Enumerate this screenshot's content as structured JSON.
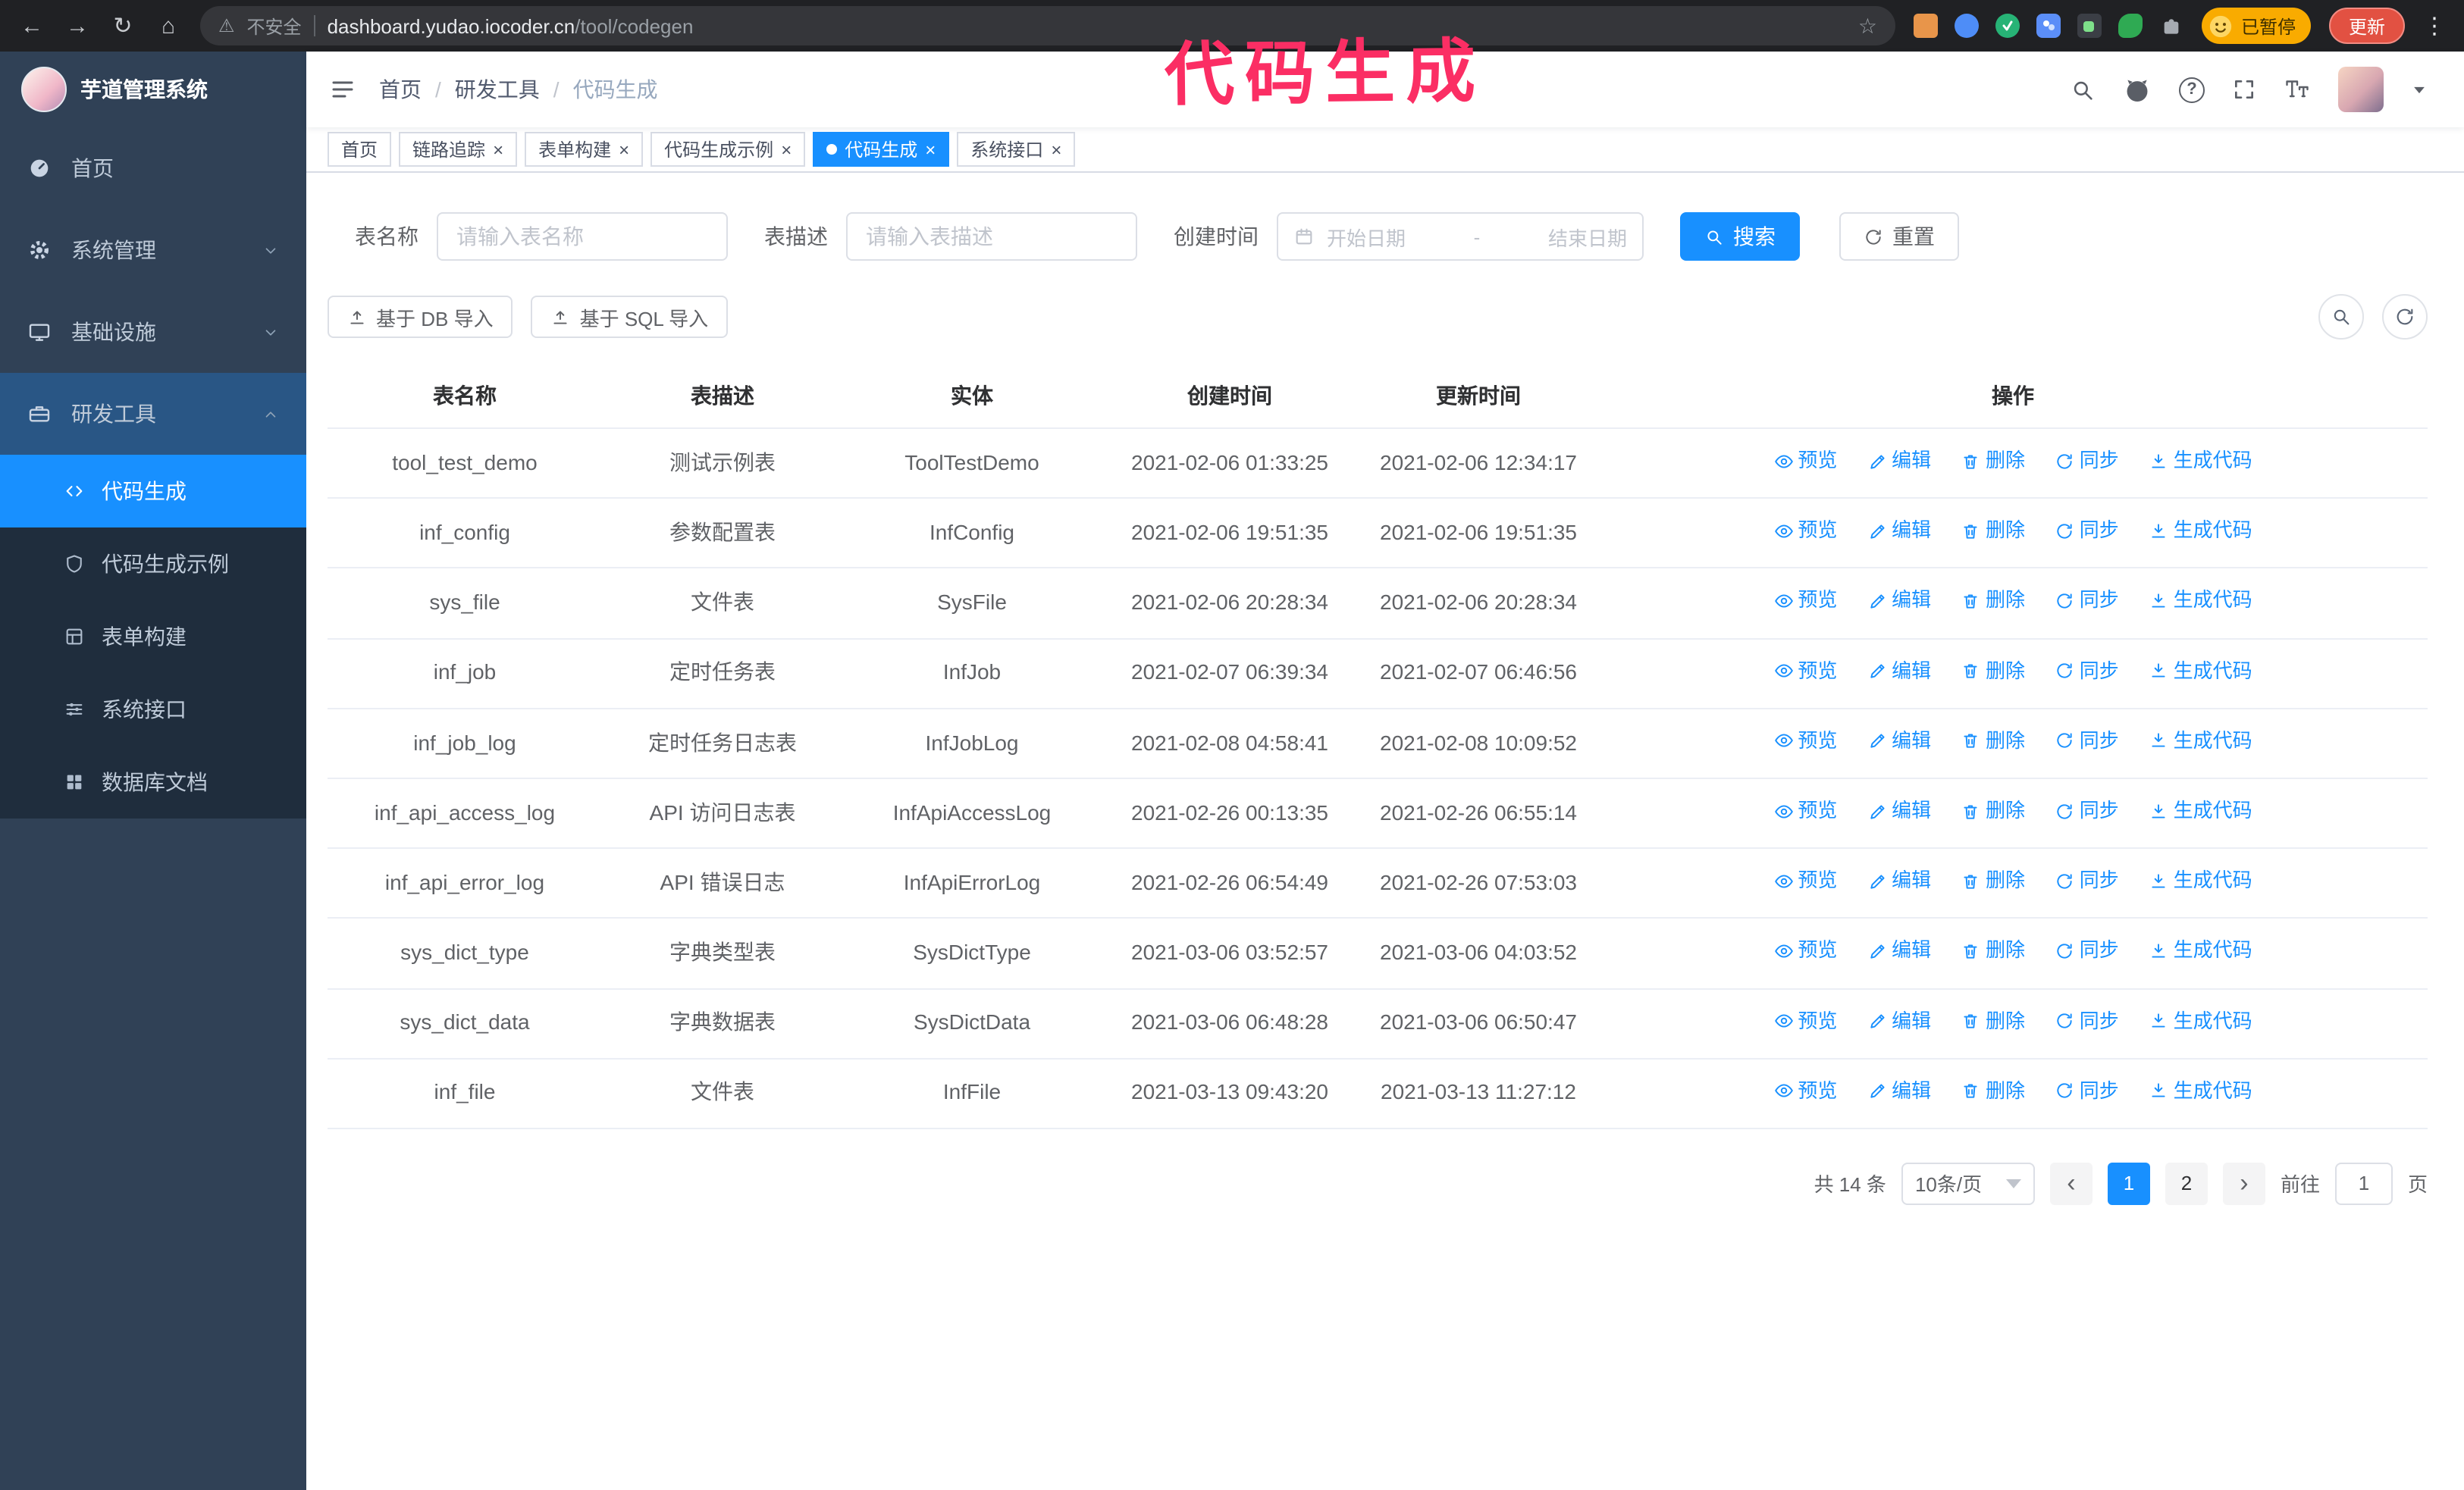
{
  "accent": "#1890ff",
  "glyphs": {
    "back": "←",
    "forward": "→",
    "reload": "↻",
    "home": "⌂",
    "warning": "⚠",
    "star": "☆",
    "kebab": "⋮",
    "close": "×",
    "question": "?"
  },
  "browser": {
    "security_label": "不安全",
    "url_host": "dashboard.yudao.iocoder.cn",
    "url_path": "/tool/codegen",
    "paused_badge": "已暂停",
    "update_button": "更新"
  },
  "annotation": {
    "text": "代码生成",
    "color": "#fb2e64"
  },
  "sidebar": {
    "app_title": "芋道管理系统",
    "items": [
      {
        "label": "首页"
      },
      {
        "label": "系统管理"
      },
      {
        "label": "基础设施"
      },
      {
        "label": "研发工具"
      }
    ],
    "sub_items": [
      {
        "label": "代码生成"
      },
      {
        "label": "代码生成示例"
      },
      {
        "label": "表单构建"
      },
      {
        "label": "系统接口"
      },
      {
        "label": "数据库文档"
      }
    ]
  },
  "breadcrumb": {
    "separator": "/",
    "items": [
      "首页",
      "研发工具",
      "代码生成"
    ]
  },
  "tabs": [
    {
      "label": "首页"
    },
    {
      "label": "链路追踪"
    },
    {
      "label": "表单构建"
    },
    {
      "label": "代码生成示例"
    },
    {
      "label": "代码生成"
    },
    {
      "label": "系统接口"
    }
  ],
  "filters": {
    "table_name_label": "表名称",
    "table_name_placeholder": "请输入表名称",
    "table_desc_label": "表描述",
    "table_desc_placeholder": "请输入表描述",
    "create_time_label": "创建时间",
    "date_start_placeholder": "开始日期",
    "date_separator": "-",
    "date_end_placeholder": "结束日期",
    "search_button": "搜索",
    "reset_button": "重置"
  },
  "toolbar": {
    "import_db_button": "基于 DB 导入",
    "import_sql_button": "基于 SQL 导入"
  },
  "table": {
    "columns": [
      "表名称",
      "表描述",
      "实体",
      "创建时间",
      "更新时间",
      "操作"
    ],
    "action_labels": [
      "预览",
      "编辑",
      "删除",
      "同步",
      "生成代码"
    ],
    "rows": [
      {
        "name": "tool_test_demo",
        "desc": "测试示例表",
        "entity": "ToolTestDemo",
        "created": "2021-02-06 01:33:25",
        "updated": "2021-02-06 12:34:17"
      },
      {
        "name": "inf_config",
        "desc": "参数配置表",
        "entity": "InfConfig",
        "created": "2021-02-06 19:51:35",
        "updated": "2021-02-06 19:51:35"
      },
      {
        "name": "sys_file",
        "desc": "文件表",
        "entity": "SysFile",
        "created": "2021-02-06 20:28:34",
        "updated": "2021-02-06 20:28:34"
      },
      {
        "name": "inf_job",
        "desc": "定时任务表",
        "entity": "InfJob",
        "created": "2021-02-07 06:39:34",
        "updated": "2021-02-07 06:46:56"
      },
      {
        "name": "inf_job_log",
        "desc": "定时任务日志表",
        "entity": "InfJobLog",
        "created": "2021-02-08 04:58:41",
        "updated": "2021-02-08 10:09:52"
      },
      {
        "name": "inf_api_access_log",
        "desc": "API 访问日志表",
        "entity": "InfApiAccessLog",
        "created": "2021-02-26 00:13:35",
        "updated": "2021-02-26 06:55:14"
      },
      {
        "name": "inf_api_error_log",
        "desc": "API 错误日志",
        "entity": "InfApiErrorLog",
        "created": "2021-02-26 06:54:49",
        "updated": "2021-02-26 07:53:03"
      },
      {
        "name": "sys_dict_type",
        "desc": "字典类型表",
        "entity": "SysDictType",
        "created": "2021-03-06 03:52:57",
        "updated": "2021-03-06 04:03:52"
      },
      {
        "name": "sys_dict_data",
        "desc": "字典数据表",
        "entity": "SysDictData",
        "created": "2021-03-06 06:48:28",
        "updated": "2021-03-06 06:50:47"
      },
      {
        "name": "inf_file",
        "desc": "文件表",
        "entity": "InfFile",
        "created": "2021-03-13 09:43:20",
        "updated": "2021-03-13 11:27:12"
      }
    ]
  },
  "pagination": {
    "total": "共 14 条",
    "page_size": "10条/页",
    "prev": "‹",
    "page_1": "1",
    "page_2": "2",
    "next": "›",
    "goto_label": "前往",
    "goto_value": "1",
    "unit": "页"
  }
}
